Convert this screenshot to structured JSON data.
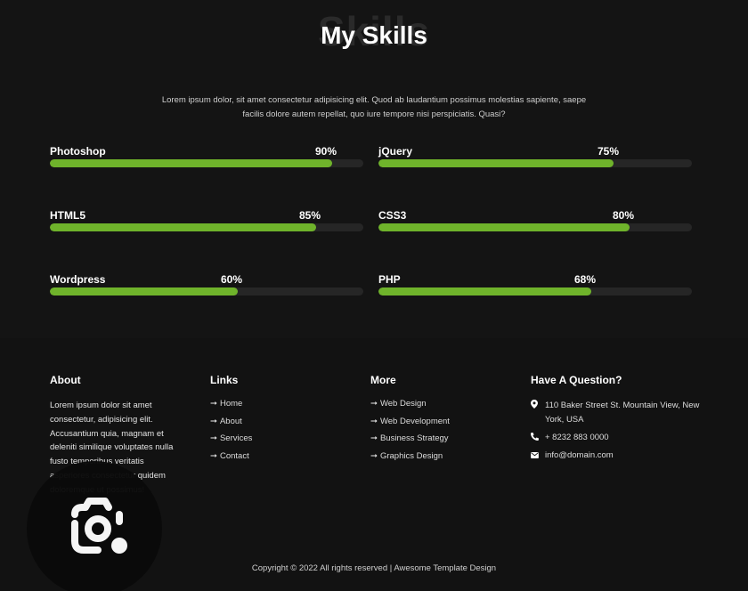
{
  "skills_section": {
    "background_word": "Skills",
    "title": "My Skills",
    "intro_line1": "Lorem ipsum dolor, sit amet consectetur adipisicing elit. Quod ab laudantium possimus molestias sapiente, saepe",
    "intro_line2": "facilis dolore autem repellat, quo iure tempore nisi perspiciatis. Quasi?",
    "accent_color": "#6fb32b",
    "skills": [
      {
        "name": "Photoshop",
        "percent_label": "90%",
        "value": 0.9
      },
      {
        "name": "jQuery",
        "percent_label": "75%",
        "value": 0.75
      },
      {
        "name": "HTML5",
        "percent_label": "85%",
        "value": 0.85
      },
      {
        "name": "CSS3",
        "percent_label": "80%",
        "value": 0.8
      },
      {
        "name": "Wordpress",
        "percent_label": "60%",
        "value": 0.6
      },
      {
        "name": "PHP",
        "percent_label": "68%",
        "value": 0.68
      }
    ]
  },
  "footer": {
    "about": {
      "heading": "About",
      "text": "Lorem ipsum dolor sit amet consectetur, adipisicing elit. Accusantium quia, magnam et deleniti similique voluptates nulla fusto temporibus veritatis asperiores consectetur quidem doloremque ut possimus!"
    },
    "links": {
      "heading": "Links",
      "items": [
        "Home",
        "About",
        "Services",
        "Contact"
      ]
    },
    "more": {
      "heading": "More",
      "items": [
        "Web Design",
        "Web Development",
        "Business Strategy",
        "Graphics Design"
      ]
    },
    "contact": {
      "heading": "Have A Question?",
      "address": "110 Baker Street St. Mountain View, New York, USA",
      "phone": "+ 8232 883 0000",
      "email": "info@domain.com",
      "icons": [
        "map-marker-icon",
        "phone-icon",
        "envelope-icon"
      ]
    },
    "copyright": "Copyright © 2022 All rights reserved | Awesome Template Design"
  }
}
